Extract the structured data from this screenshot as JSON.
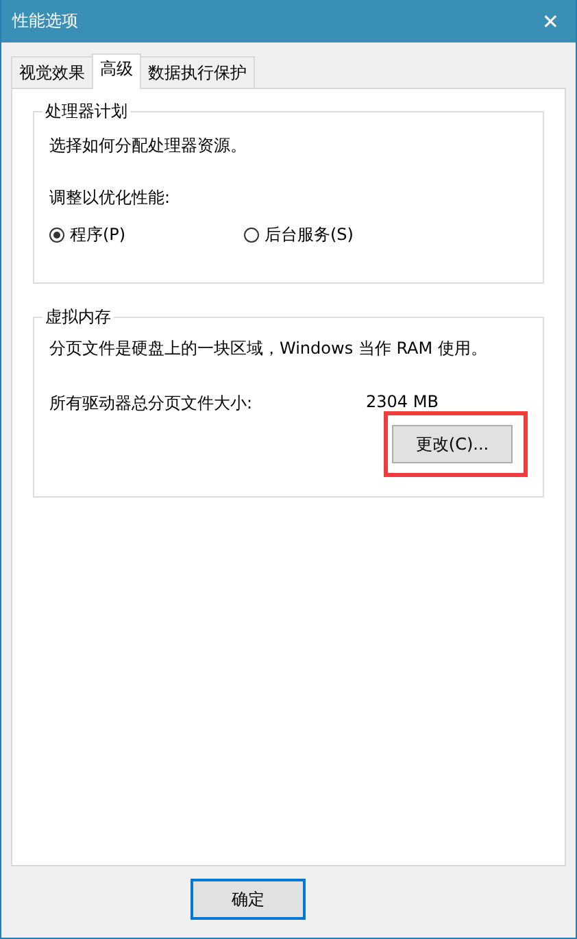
{
  "window": {
    "title": "性能选项",
    "close": "✕"
  },
  "tabs": [
    {
      "label": "视觉效果",
      "selected": false
    },
    {
      "label": "高级",
      "selected": true
    },
    {
      "label": "数据执行保护",
      "selected": false
    }
  ],
  "processor_group": {
    "title": "处理器计划",
    "description": "选择如何分配处理器资源。",
    "prompt": "调整以优化性能:",
    "options": [
      {
        "label": "程序(P)",
        "selected": true
      },
      {
        "label": "后台服务(S)",
        "selected": false
      }
    ]
  },
  "memory_group": {
    "title": "虚拟内存",
    "description": "分页文件是硬盘上的一块区域，Windows 当作 RAM 使用。",
    "size_label": "所有驱动器总分页文件大小:",
    "size_value": "2304 MB",
    "change_button": {
      "label": "更改(C)...",
      "highlighted": true
    }
  },
  "buttons": [
    {
      "label": "确定",
      "default": true
    }
  ]
}
